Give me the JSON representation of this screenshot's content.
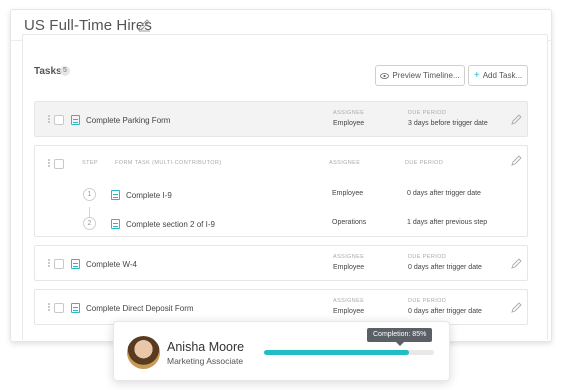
{
  "page": {
    "title": "US Full-Time Hires"
  },
  "tasks": {
    "heading": "Tasks",
    "count": "5",
    "preview_label": "Preview Timeline...",
    "add_label": "Add Task...",
    "assignee_label": "ASSIGNEE",
    "due_label": "DUE PERIOD",
    "rows": [
      {
        "name": "Complete Parking Form",
        "assignee": "Employee",
        "due": "3 days before trigger date"
      },
      {
        "name": "Complete W-4",
        "assignee": "Employee",
        "due": "0 days after trigger date"
      },
      {
        "name": "Complete Direct Deposit Form",
        "assignee": "Employee",
        "due": "0 days after trigger date"
      }
    ],
    "multi": {
      "step_label": "STEP",
      "form_task_label": "FORM TASK (MULTI-CONTRIBUTOR)",
      "assignee_label": "ASSIGNEE",
      "due_label": "DUE PERIOD",
      "steps": [
        {
          "num": "1",
          "name": "Complete I-9",
          "assignee": "Employee",
          "due": "0 days after trigger date"
        },
        {
          "num": "2",
          "name": "Complete section 2 of I-9",
          "assignee": "Operations",
          "due": "1 days after previous step"
        }
      ]
    }
  },
  "popup": {
    "name": "Anisha Moore",
    "role": "Marketing Associate",
    "tooltip": "Completion: 85%",
    "progress": 0.85
  },
  "colors": {
    "accent": "#21bdc4",
    "tooltip_bg": "#5a6066"
  }
}
